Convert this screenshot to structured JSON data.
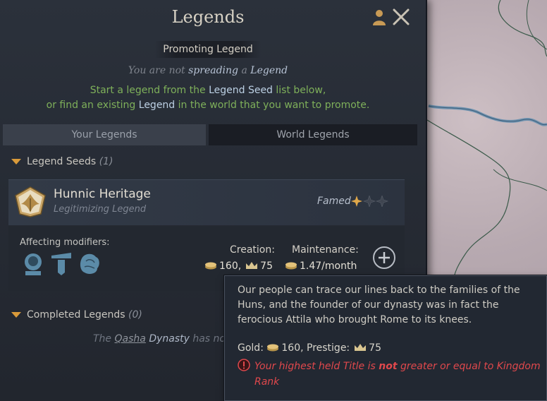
{
  "window": {
    "title": "Legends"
  },
  "promoting": {
    "header": "Promoting Legend",
    "status_prefix": "You are not",
    "status_verb": "spreading",
    "status_mid": "a",
    "status_obj": "Legend",
    "hint_line1_a": "Start a legend from the",
    "hint_line1_b": "Legend Seed",
    "hint_line1_c": "list below,",
    "hint_line2_a": "or find an existing",
    "hint_line2_b": "Legend",
    "hint_line2_c": "in the world that you want to promote."
  },
  "tabs": [
    {
      "label": "Your Legends",
      "active": true
    },
    {
      "label": "World Legends",
      "active": false
    }
  ],
  "seeds_section": {
    "label": "Legend Seeds",
    "count": "(1)"
  },
  "legend": {
    "name": "Hunnic Heritage",
    "type": "Legitimizing Legend",
    "quality": "Famed",
    "affecting_label": "Affecting modifiers:",
    "creation_label": "Creation:",
    "creation_gold": "160,",
    "creation_prestige": "75",
    "maintenance_label": "Maintenance:",
    "maintenance_value": "1.47/month"
  },
  "completed_section": {
    "label": "Completed Legends",
    "count": "(0)"
  },
  "dynasty_line": {
    "prefix": "The",
    "name": "Qasha",
    "word": "Dynasty",
    "suffix": "has not c"
  },
  "tooltip": {
    "description": "Our people can trace our lines back to the families of the Huns, and the founder of our dynasty was in fact the ferocious Attila who brought Rome to its knees.",
    "gold_label": "Gold:",
    "gold_value": "160,",
    "prestige_label": "Prestige:",
    "prestige_value": "75",
    "warn_a": "Your highest held Title is",
    "warn_not": "not",
    "warn_b": "greater or equal to Kingdom",
    "warn_c": "Rank"
  },
  "colors": {
    "accent_gold": "#d99a3a",
    "hint_green": "#7eb05a",
    "error_red": "#e0484c"
  }
}
